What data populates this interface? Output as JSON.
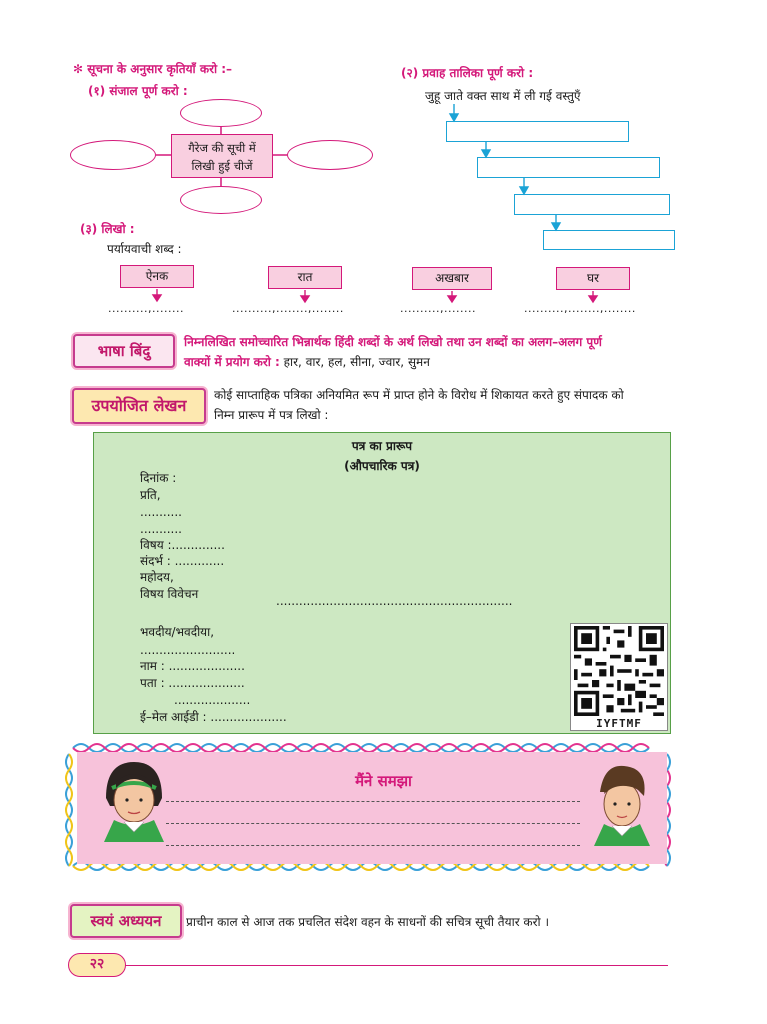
{
  "activity_header": "✻ सूचना के अनुसार कृतियाँ करो :–",
  "q1": {
    "title": "(१) संजाल पूर्ण करो :",
    "center_line1": "गैरेज की सूची में",
    "center_line2": "लिखी हुई चीजें"
  },
  "q2": {
    "title": "(२) प्रवाह तालिका पूर्ण करो :",
    "start_text": "जुहू जाते वक्त साथ में ली गई  वस्तुएँ"
  },
  "q3": {
    "title": "(३) लिखो :",
    "subtitle": "पर्यायवाची शब्द :",
    "words": [
      "ऐनक",
      "रात",
      "अखबार",
      "घर"
    ],
    "answers": [
      "..........,........",
      "..........,........,........",
      "..........,........",
      "..........,........,........"
    ]
  },
  "bhasha_bindu": {
    "badge": "भाषा बिंदु",
    "line1": "निम्नलिखित समोच्चारित भिन्नार्थक हिंदी शब्दों के अर्थ लिखो तथा उन शब्दों का अलग–अलग पूर्ण",
    "line2_prefix": "वाक्यों में प्रयोग करो :",
    "line2_words": "हार, वार, हल, सीना, ज्वार, सुमन"
  },
  "upayojit_lekhan": {
    "badge": "उपयोजित लेखन",
    "line1": "कोई साप्ताहिक पत्रिका अनियमित रूप में प्राप्त होने के विरोध में शिकायत करते हुए संपादक को",
    "line2": "निम्न प्रारूप में पत्र लिखो :"
  },
  "letter": {
    "title": "पत्र का प्रारूप",
    "subtitle": "(औपचारिक पत्र)",
    "date": "दिनांक :",
    "to": "प्रति,",
    "addr1": "...........",
    "addr2": "...........",
    "subject": "विषय :..............",
    "reference": "संदर्भ : .............",
    "salutation": "महोदय,",
    "body_label": "विषय विवेचन",
    "body_dots": "..............................................................",
    "closing": "भवदीय/भवदीया,",
    "sign_dots": ".........................",
    "name": "नाम : ....................",
    "address": "पता : ....................",
    "address2": "....................",
    "email": "ई–मेल आईडी : ....................",
    "qr_code": "IYFTMF"
  },
  "maine_samjha": {
    "title": "मैंने समझा"
  },
  "swayam_adhyayan": {
    "badge": "स्वयं अध्ययन",
    "text": "प्राचीन काल से आज तक प्रचलित संदेश वहन के साधनों की सचित्र सूची तैयार करो ।"
  },
  "page_number": "२२",
  "colors": {
    "accent": "#d4197a",
    "flow_box": "#1ba3d6",
    "letter_bg": "#cde8c2",
    "understood_bg": "#f7c2da"
  }
}
